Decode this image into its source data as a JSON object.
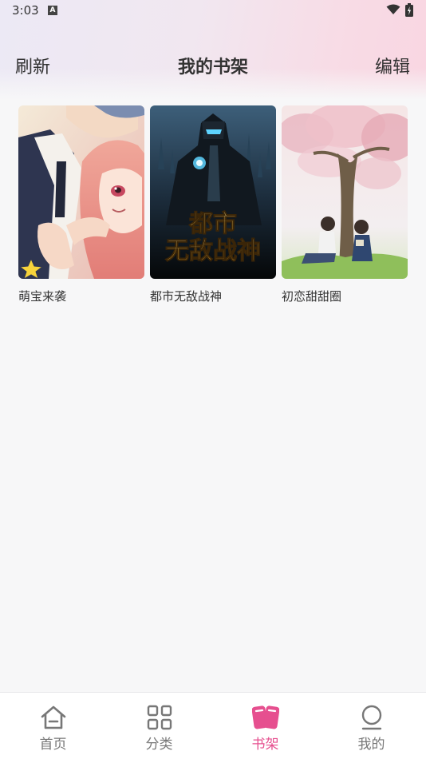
{
  "status_bar": {
    "time": "3:03",
    "notification_letter": "A"
  },
  "header": {
    "refresh_label": "刷新",
    "title": "我的书架",
    "edit_label": "编辑"
  },
  "books": [
    {
      "title": "萌宝来袭",
      "cover_icon": "romance-manga-cover"
    },
    {
      "title": "都市无敌战神",
      "cover_icon": "dark-warrior-cover",
      "cover_text": "都市无敌战神"
    },
    {
      "title": "初恋甜甜圈",
      "cover_icon": "cherry-blossom-couple-cover"
    }
  ],
  "bottom_nav": {
    "items": [
      {
        "label": "首页",
        "icon": "home-icon"
      },
      {
        "label": "分类",
        "icon": "grid-icon"
      },
      {
        "label": "书架",
        "icon": "bookshelf-icon",
        "active": true
      },
      {
        "label": "我的",
        "icon": "profile-icon"
      }
    ]
  },
  "colors": {
    "accent": "#e64f8f",
    "inactive": "#777777",
    "background": "#f7f7f8"
  }
}
